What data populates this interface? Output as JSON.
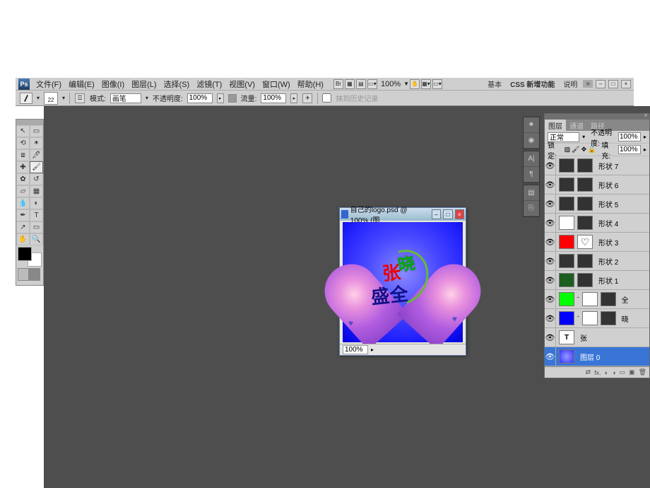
{
  "menubar": {
    "logo": "Ps",
    "items": [
      "文件(F)",
      "编辑(E)",
      "图像(I)",
      "图层(L)",
      "选择(S)",
      "滤镜(T)",
      "视图(V)",
      "窗口(W)",
      "帮助(H)"
    ],
    "zoom_readout": "100%",
    "right_buttons": [
      "基本",
      "CSS 新增功能",
      "说明"
    ]
  },
  "optbar": {
    "brush_size": "22",
    "mode_label": "模式:",
    "mode_value": "画笔",
    "opacity_label": "不透明度:",
    "opacity_value": "100%",
    "flow_label": "流量:",
    "flow_value": "100%",
    "history_label": "抹到历史记录"
  },
  "layers_panel": {
    "tabs": [
      "图层",
      "通道",
      "路径"
    ],
    "blend_mode": "正常",
    "opacity_label": "不透明度:",
    "opacity_value": "100%",
    "lock_label": "锁定:",
    "fill_label": "填充:",
    "fill_value": "100%",
    "layers": [
      {
        "name": "形状 7",
        "eye": true,
        "swatches": [
          {
            "bg": "#333"
          },
          {
            "bg": "#333"
          }
        ]
      },
      {
        "name": "形状 6",
        "eye": true,
        "swatches": [
          {
            "bg": "#333"
          },
          {
            "bg": "#333"
          }
        ]
      },
      {
        "name": "形状 5",
        "eye": true,
        "swatches": [
          {
            "bg": "#333"
          },
          {
            "bg": "#333"
          }
        ]
      },
      {
        "name": "形状 4",
        "eye": true,
        "swatches": [
          {
            "bg": "#fff",
            "border": "#444"
          },
          {
            "bg": "#333"
          }
        ]
      },
      {
        "name": "形状 3",
        "eye": true,
        "swatches": [
          {
            "bg": "#ff0000"
          },
          {
            "bg": "#fff",
            "heart": true
          }
        ]
      },
      {
        "name": "形状 2",
        "eye": true,
        "swatches": [
          {
            "bg": "#333"
          },
          {
            "bg": "#333"
          }
        ]
      },
      {
        "name": "形状 1",
        "eye": true,
        "swatches": [
          {
            "bg": "#1b5e20"
          },
          {
            "bg": "#333"
          }
        ]
      },
      {
        "name": "全",
        "eye": true,
        "swatches": [
          {
            "bg": "#00ff00"
          },
          {
            "bg": "#fff"
          },
          {
            "bg": "#333"
          }
        ],
        "link": true
      },
      {
        "name": "晓",
        "eye": true,
        "swatches": [
          {
            "bg": "#0000ff"
          },
          {
            "bg": "#fff"
          },
          {
            "bg": "#333"
          }
        ],
        "link": true
      },
      {
        "name": "张",
        "eye": true,
        "type": "T"
      },
      {
        "name": "图层 0",
        "eye": true,
        "selected": true,
        "swatches": [
          {
            "bg": "radial-gradient(circle,#99f,#33f)"
          }
        ]
      }
    ]
  },
  "document": {
    "title": "自己的logo.psd @ 100% (图...",
    "zoom": "100%"
  }
}
